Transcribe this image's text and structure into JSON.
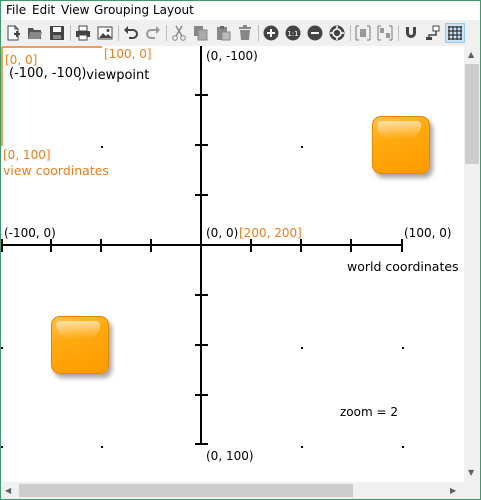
{
  "menu": [
    "File",
    "Edit",
    "View",
    "Grouping",
    "Layout"
  ],
  "toolbar": {
    "buttons": [
      "new-icon",
      "open-icon",
      "save-icon",
      "print-icon",
      "export-image-icon",
      "undo-icon",
      "redo-icon",
      "cut-icon",
      "copy-icon",
      "paste-icon",
      "delete-icon",
      "zoom-in-icon",
      "zoom-original-icon",
      "zoom-out-icon",
      "fit-content-icon",
      "group-icon",
      "ungroup-icon",
      "snapping-icon",
      "orthogonal-edges-icon",
      "grid-icon"
    ],
    "zoom_original_label": "1:1",
    "selected": "grid-icon"
  },
  "labels": {
    "view_top_left": "[0, 0]",
    "view_top_right": "[100, 0]",
    "viewpoint_coords": "(-100, -100)",
    "viewpoint_text": ", viewpoint",
    "view_bottom_left": "[0, 100]",
    "view_coordinates": "view coordinates",
    "axis_top": "(0, -100)",
    "axis_left": "(-100, 0)",
    "origin": "(0, 0)",
    "origin_view": "[200, 200]",
    "axis_right": "(100, 0)",
    "world_coordinates": "world coordinates",
    "axis_bottom": "(0, 100)",
    "zoom": "zoom = 2"
  },
  "colors": {
    "view_accent": "#f07c1c",
    "node_fill": "#ffa500",
    "selected_button": "#cce4f7"
  }
}
